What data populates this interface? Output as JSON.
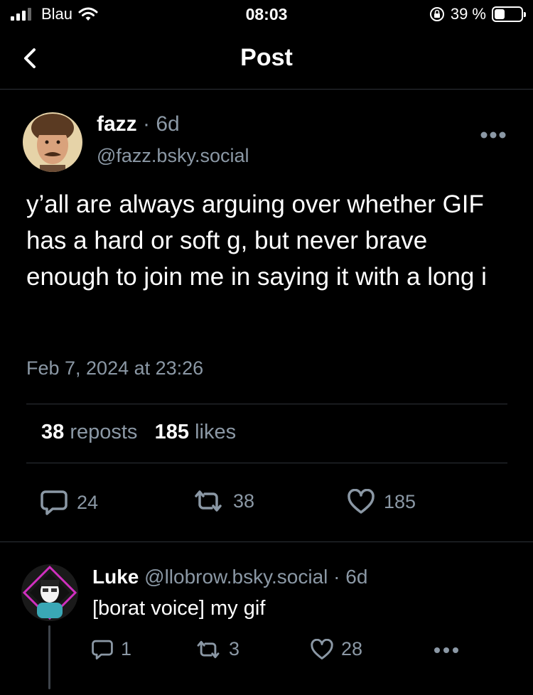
{
  "status_bar": {
    "carrier": "Blau",
    "time": "08:03",
    "battery": "39 %",
    "battery_level": 0.39
  },
  "header": {
    "title": "Post"
  },
  "post": {
    "author_name": "fazz",
    "age": "· 6d",
    "handle": "@fazz.bsky.social",
    "text": "y’all are always arguing over whether GIF has a hard or soft g, but never brave enough to join me in saying it with a long i",
    "timestamp": "Feb 7, 2024 at 23:26",
    "reposts_count": "38",
    "reposts_label": "reposts",
    "likes_count": "185",
    "likes_label": "likes",
    "actions": {
      "reply_count": "24",
      "repost_count": "38",
      "like_count": "185"
    }
  },
  "reply": {
    "author_name": "Luke",
    "handle_age": "@llobrow.bsky.social · 6d",
    "text": "[borat voice] my gif",
    "reply_count": "1",
    "repost_count": "3",
    "like_count": "28"
  },
  "icons": {
    "back": "chevron-left-icon",
    "more": "ellipsis-icon",
    "reply": "speech-bubble-icon",
    "repost": "repost-arrows-icon",
    "like": "heart-icon"
  }
}
